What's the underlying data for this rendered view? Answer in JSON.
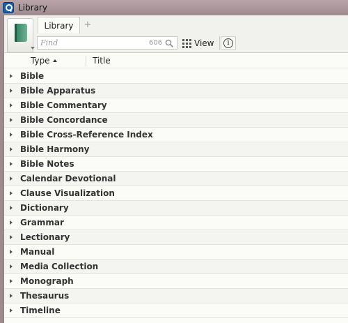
{
  "window": {
    "title": "Library"
  },
  "toolbar": {
    "tab_label": "Library",
    "tab_add": "+",
    "find_placeholder": "Find",
    "find_count": "606",
    "view_label": "View",
    "info_label": "i"
  },
  "columns": {
    "type": "Type",
    "title": "Title"
  },
  "types": [
    "Bible",
    "Bible Apparatus",
    "Bible Commentary",
    "Bible Concordance",
    "Bible Cross-Reference Index",
    "Bible Harmony",
    "Bible Notes",
    "Calendar Devotional",
    "Clause Visualization",
    "Dictionary",
    "Grammar",
    "Lectionary",
    "Manual",
    "Media Collection",
    "Monograph",
    "Thesaurus",
    "Timeline"
  ],
  "colors": {
    "titlebar": "#9e8b8f",
    "panel": "#fbfbf8",
    "toolbar": "#f1f1ee",
    "book_icon": "#2f7e5d"
  }
}
